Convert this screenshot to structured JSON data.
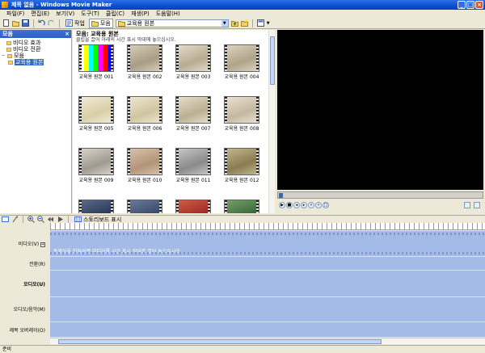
{
  "window": {
    "title": "제목 없음 - Windows Movie Maker"
  },
  "menu": [
    "파일(F)",
    "편집(E)",
    "보기(V)",
    "도구(T)",
    "클립(C)",
    "재생(P)",
    "도움말(H)"
  ],
  "toolbar": {
    "tasks_label": "작업",
    "collections_label": "모음",
    "collection_selected": "교육용 원본"
  },
  "tree": {
    "header": "모음",
    "items": [
      {
        "label": "비디오 효과",
        "depth": 1
      },
      {
        "label": "비디오 전환",
        "depth": 1
      },
      {
        "label": "모음",
        "depth": 0
      },
      {
        "label": "교육용 원본",
        "depth": 1,
        "selected": true
      }
    ]
  },
  "contents": {
    "title": "모음: 교육용 원본",
    "subtitle": "클립을 끌어 아래의 시간 표시 막대에 놓으십시오.",
    "clips": [
      {
        "caption": "교육용 원본 001",
        "colors": [
          "#c9b9a0",
          "#e8e0d0"
        ]
      },
      {
        "caption": "교육용 원본 002",
        "colors": [
          "#a89c84",
          "#d8d0bc"
        ]
      },
      {
        "caption": "교육용 원본 003",
        "colors": [
          "#b8ac92",
          "#e4dccb"
        ]
      },
      {
        "caption": "교육용 원본 004",
        "colors": [
          "#b0a488",
          "#ddd5c2"
        ]
      },
      {
        "caption": "교육용 원본 005",
        "colors": [
          "#d8cfa8",
          "#f1ecd8"
        ]
      },
      {
        "caption": "교육용 원본 006",
        "colors": [
          "#cfc6a0",
          "#eee8d2"
        ]
      },
      {
        "caption": "교육용 원본 007",
        "colors": [
          "#bcb092",
          "#e6dfcc"
        ]
      },
      {
        "caption": "교육용 원본 008",
        "colors": [
          "#c4b8a0",
          "#eae3d3"
        ]
      },
      {
        "caption": "교육용 원본 009",
        "colors": [
          "#a09a90",
          "#d8d4cc"
        ]
      },
      {
        "caption": "교육용 원본 010",
        "colors": [
          "#b49478",
          "#d8c4ac"
        ]
      },
      {
        "caption": "교육용 원본 011",
        "colors": [
          "#8a8a8a",
          "#c8c8c8"
        ]
      },
      {
        "caption": "교육용 원본 012",
        "colors": [
          "#8a7c50",
          "#c2b890"
        ]
      },
      {
        "caption": "",
        "colors": [
          "#2a3a5a",
          "#5b6b8a"
        ]
      },
      {
        "caption": "",
        "colors": [
          "#3a4a6a",
          "#6b7b9a"
        ]
      },
      {
        "caption": "",
        "colors": [
          "#a02a2a",
          "#d06040"
        ]
      },
      {
        "caption": "",
        "colors": [
          "#3a6a3a",
          "#7aa06a"
        ]
      }
    ]
  },
  "timeline": {
    "toolbar_label": "스토리보드 표시",
    "tracks": [
      "비디오(V)",
      "전환(R)",
      "오디오(U)",
      "오디오/음악(M)",
      "제목 오버레이(O)"
    ],
    "video_hint": "동영상을 만들려면 미디어를 시간 표시 막대로 끌어 놓으십시오."
  },
  "status": {
    "text": "준비"
  }
}
